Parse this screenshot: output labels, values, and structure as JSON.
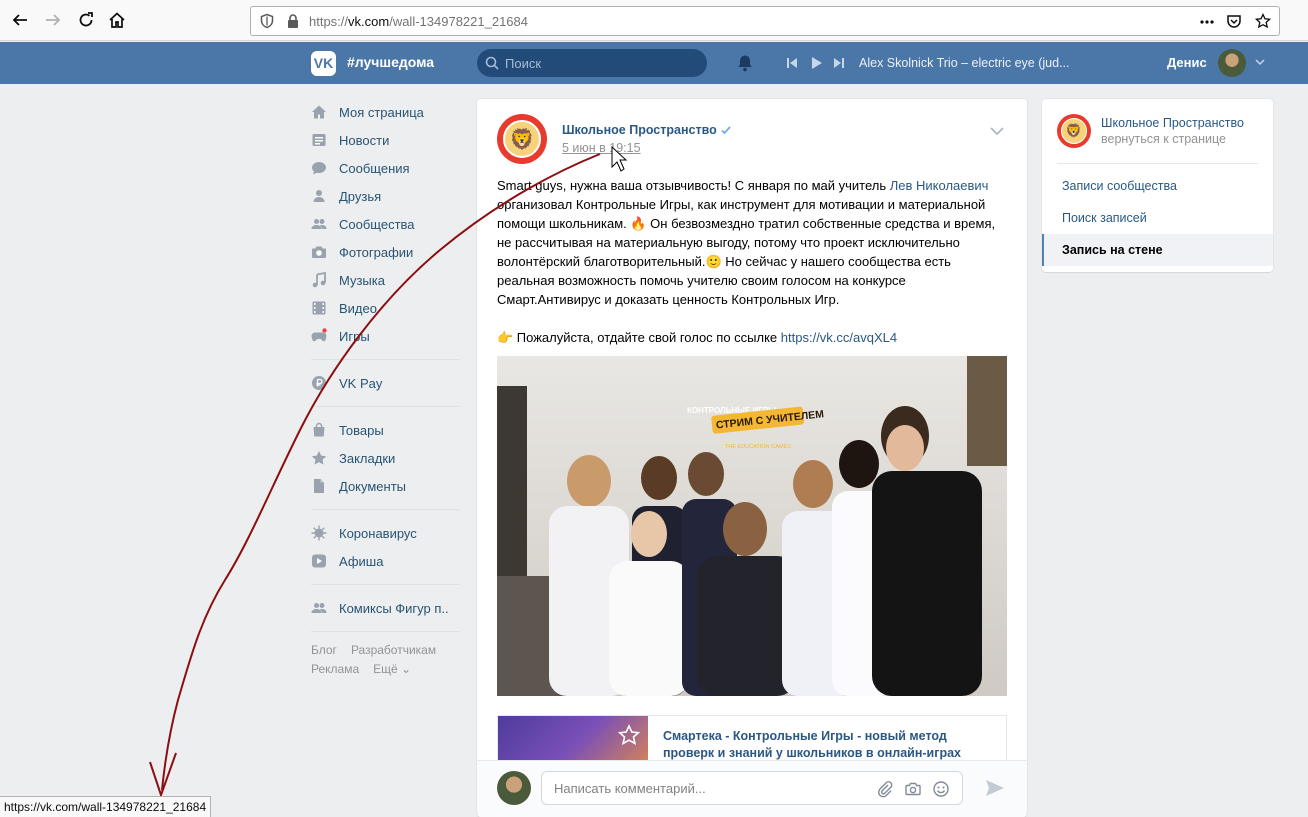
{
  "browser": {
    "url_prefix": "https://",
    "url_host": "vk.com",
    "url_path": "/wall-134978221_21684",
    "status_url": "https://vk.com/wall-134978221_21684"
  },
  "header": {
    "logo": "VK",
    "hashtag": "#лучшедома",
    "search_placeholder": "Поиск",
    "track": "Alex Skolnick Trio – electric eye (jud...",
    "user_name": "Денис"
  },
  "menu": {
    "group1": [
      {
        "label": "Моя страница",
        "icon": "home-icon"
      },
      {
        "label": "Новости",
        "icon": "news-icon"
      },
      {
        "label": "Сообщения",
        "icon": "messages-icon"
      },
      {
        "label": "Друзья",
        "icon": "friends-icon"
      },
      {
        "label": "Сообщества",
        "icon": "groups-icon"
      },
      {
        "label": "Фотографии",
        "icon": "camera-icon"
      },
      {
        "label": "Музыка",
        "icon": "music-icon"
      },
      {
        "label": "Видео",
        "icon": "video-icon"
      },
      {
        "label": "Игры",
        "icon": "games-icon"
      }
    ],
    "group2": [
      {
        "label": "VK Pay",
        "icon": "vkpay-icon"
      }
    ],
    "group3": [
      {
        "label": "Товары",
        "icon": "bag-icon"
      },
      {
        "label": "Закладки",
        "icon": "star-icon"
      },
      {
        "label": "Документы",
        "icon": "document-icon"
      }
    ],
    "group4": [
      {
        "label": "Коронавирус",
        "icon": "virus-icon"
      },
      {
        "label": "Афиша",
        "icon": "play-icon"
      }
    ],
    "group5": [
      {
        "label": "Комиксы Фигур п..",
        "icon": "group-icon"
      }
    ],
    "footer": {
      "blog": "Блог",
      "developers": "Разработчикам",
      "ads": "Реклама",
      "more": "Ещё ⌄"
    }
  },
  "post": {
    "author": "Школьное Пространство",
    "date": "5 июн в 19:15",
    "text_p1_a": "Smart guys, нужна ваша отзывчивость! С января по май учитель ",
    "text_p1_link": "Лев Николаевич",
    "text_p1_b": " организовал Контрольные Игры, как инструмент для мотивации и материальной помощи школьникам. 🔥 Он безвозмездно тратил собственные средства и время, не рассчитывая на материальную выгоду, потому что проект исключительно волонтёрский благотворительный.🙂 Но сейчас у нашего сообщества есть реальная возможность помочь учителю своим голосом на конкурсе Смарт.Антивирус и доказать ценность Контрольных Игр.",
    "text_p2_a": "👉 Пожалуйста, отдайте свой голос по ссылке ",
    "text_p2_link": "https://vk.cc/avqXL4",
    "photo_sign_top": "КОНТРОЛЬНЫЕ ИГРЫ",
    "photo_sign_main": "СТРИМ С УЧИТЕЛЕМ",
    "photo_sign_sub": "THE EDUCATION GAMES",
    "link_title": "Смартека - Контрольные Игры - новый метод проверк и знаний у школьников в онлайн-играх",
    "comment_placeholder": "Написать комментарий..."
  },
  "right": {
    "group_name": "Школьное Пространство",
    "back": "вернуться к странице",
    "items": [
      {
        "label": "Записи сообщества"
      },
      {
        "label": "Поиск записей"
      },
      {
        "label": "Запись на стене"
      }
    ]
  },
  "colors": {
    "vk_header": "#4a76a8",
    "link": "#2a5885",
    "annotation": "#8b0f12"
  }
}
